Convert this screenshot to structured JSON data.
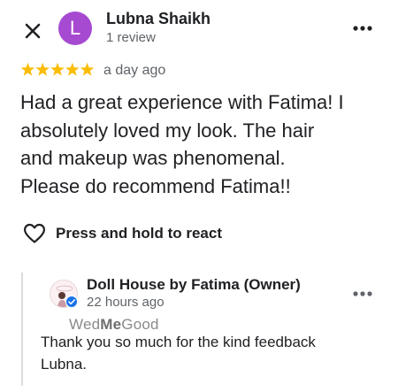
{
  "header": {
    "avatar_letter": "L",
    "avatar_color": "#a64ad1",
    "reviewer_name": "Lubna Shaikh",
    "review_count": "1 review",
    "close_icon": "close-icon",
    "menu_icon": "more-horizontal-icon"
  },
  "review": {
    "rating": 5,
    "rating_max": 5,
    "star_color": "#fbbc04",
    "time": "a day ago",
    "text": "Had a great experience with Fatima! I\nabsolutely loved my look. The hair\nand makeup was phenomenal.\nPlease do recommend Fatima!!"
  },
  "react": {
    "label": "Press and hold to react",
    "icon": "heart-outline-icon"
  },
  "owner_reply": {
    "owner_name": "Doll House by Fatima (Owner)",
    "time": "22 hours ago",
    "verified_color": "#1a73e8",
    "text": "Thank you so much for the kind feedback\nLubna.",
    "menu_icon": "more-horizontal-icon"
  },
  "watermark": {
    "part1": "Wed",
    "part2": "Me",
    "part3": "Good"
  }
}
